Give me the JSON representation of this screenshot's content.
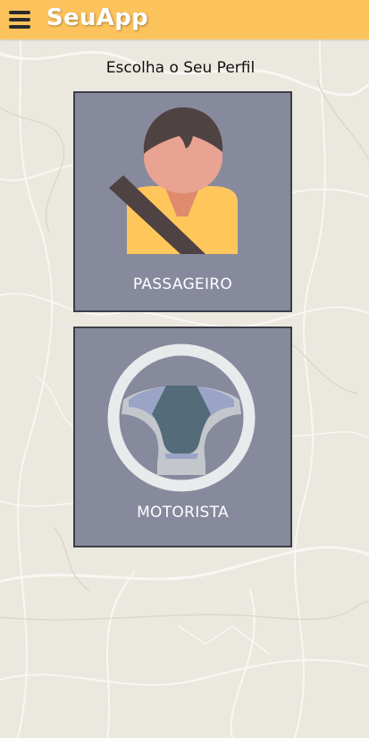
{
  "header": {
    "app_title": "SeuApp",
    "background_color": "#fcc35c",
    "menu_icon": "hamburger-menu-icon"
  },
  "main": {
    "title": "Escolha o Seu Perfil",
    "profiles": [
      {
        "label": "PASSAGEIRO",
        "icon": "passenger-seatbelt-icon"
      },
      {
        "label": "MOTORISTA",
        "icon": "steering-wheel-icon"
      }
    ],
    "card_color": "#878a9d"
  }
}
